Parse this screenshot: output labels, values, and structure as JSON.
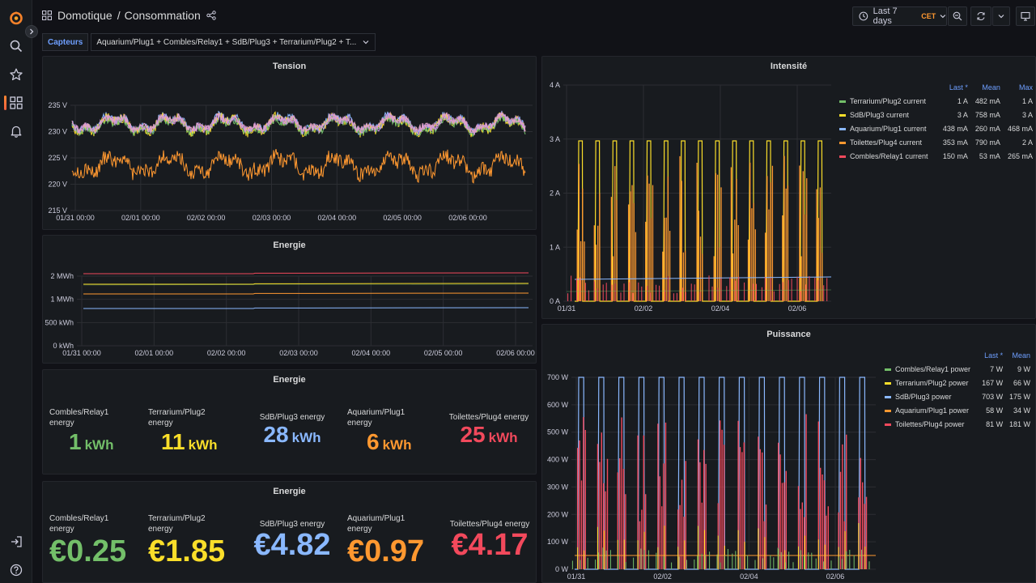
{
  "nav": {
    "breadcrumb_folder": "Domotique",
    "breadcrumb_sep": "/",
    "breadcrumb_dashboard": "Consommation",
    "time_range": "Last 7 days",
    "timezone": "CET"
  },
  "variables": {
    "label": "Capteurs",
    "value": "Aquarium/Plug1 + Combles/Relay1 + SdB/Plug3 + Terrarium/Plug2 + T..."
  },
  "colors": {
    "green": "#73bf69",
    "yellow": "#fade2a",
    "blue": "#8ab8ff",
    "orange": "#ff9830",
    "red": "#f2495c",
    "pink": "#e0a0c8",
    "purple": "#ca95e5"
  },
  "panels": {
    "tension": {
      "title": "Tension",
      "y_ticks": [
        "235 V",
        "230 V",
        "225 V",
        "220 V",
        "215 V"
      ],
      "x_ticks": [
        "01/31 00:00",
        "02/01 00:00",
        "02/02 00:00",
        "02/03 00:00",
        "02/04 00:00",
        "02/05 00:00",
        "02/06 00:00"
      ]
    },
    "energie_graph": {
      "title": "Energie",
      "y_ticks": [
        "2 MWh",
        "1 MWh",
        "500 kWh",
        "0 kWh"
      ],
      "x_ticks": [
        "01/31 00:00",
        "02/01 00:00",
        "02/02 00:00",
        "02/03 00:00",
        "02/04 00:00",
        "02/05 00:00",
        "02/06 00:00"
      ]
    },
    "energie_kwh": {
      "title": "Energie",
      "stats": [
        {
          "label": "Combles/Relay1 energy",
          "value": "1",
          "unit": "kWh",
          "color": "#73bf69"
        },
        {
          "label": "Terrarium/Plug2 energy",
          "value": "11",
          "unit": "kWh",
          "color": "#fade2a"
        },
        {
          "label": "SdB/Plug3 energy",
          "value": "28",
          "unit": "kWh",
          "color": "#8ab8ff"
        },
        {
          "label": "Aquarium/Plug1 energy",
          "value": "6",
          "unit": "kWh",
          "color": "#ff9830"
        },
        {
          "label": "Toilettes/Plug4 energy",
          "value": "25",
          "unit": "kWh",
          "color": "#f2495c"
        }
      ]
    },
    "energie_cost": {
      "title": "Energie",
      "stats": [
        {
          "label": "Combles/Relay1 energy",
          "value": "€0.25",
          "color": "#73bf69"
        },
        {
          "label": "Terrarium/Plug2 energy",
          "value": "€1.85",
          "color": "#fade2a"
        },
        {
          "label": "SdB/Plug3 energy",
          "value": "€4.82",
          "color": "#8ab8ff"
        },
        {
          "label": "Aquarium/Plug1 energy",
          "value": "€0.97",
          "color": "#ff9830"
        },
        {
          "label": "Toilettes/Plug4 energy",
          "value": "€4.17",
          "color": "#f2495c"
        }
      ]
    },
    "intensite": {
      "title": "Intensité",
      "y_ticks": [
        "4 A",
        "3 A",
        "2 A",
        "1 A",
        "0 A"
      ],
      "x_ticks": [
        "01/31",
        "02/02",
        "02/04",
        "02/06"
      ],
      "legend_headers": [
        "Last *",
        "Mean",
        "Max"
      ],
      "legend": [
        {
          "name": "Terrarium/Plug2 current",
          "last": "1 A",
          "mean": "482 mA",
          "max": "1 A",
          "color": "#73bf69"
        },
        {
          "name": "SdB/Plug3 current",
          "last": "3 A",
          "mean": "758 mA",
          "max": "3 A",
          "color": "#fade2a"
        },
        {
          "name": "Aquarium/Plug1 current",
          "last": "438 mA",
          "mean": "260 mA",
          "max": "468 mA",
          "color": "#8ab8ff"
        },
        {
          "name": "Toilettes/Plug4 current",
          "last": "353 mA",
          "mean": "790 mA",
          "max": "2 A",
          "color": "#ff9830"
        },
        {
          "name": "Combles/Relay1 current",
          "last": "150 mA",
          "mean": "53 mA",
          "max": "265 mA",
          "color": "#f2495c"
        }
      ]
    },
    "puissance": {
      "title": "Puissance",
      "y_ticks": [
        "700 W",
        "600 W",
        "500 W",
        "400 W",
        "300 W",
        "200 W",
        "100 W",
        "0 W"
      ],
      "x_ticks": [
        "01/31",
        "02/02",
        "02/04",
        "02/06"
      ],
      "legend_headers": [
        "Last *",
        "Mean"
      ],
      "legend": [
        {
          "name": "Combles/Relay1 power",
          "last": "7 W",
          "mean": "9 W",
          "color": "#73bf69"
        },
        {
          "name": "Terrarium/Plug2 power",
          "last": "167 W",
          "mean": "66 W",
          "color": "#fade2a"
        },
        {
          "name": "SdB/Plug3 power",
          "last": "703 W",
          "mean": "175 W",
          "color": "#8ab8ff"
        },
        {
          "name": "Aquarium/Plug1 power",
          "last": "58 W",
          "mean": "34 W",
          "color": "#ff9830"
        },
        {
          "name": "Toilettes/Plug4 power",
          "last": "81 W",
          "mean": "181 W",
          "color": "#f2495c"
        }
      ]
    }
  }
}
